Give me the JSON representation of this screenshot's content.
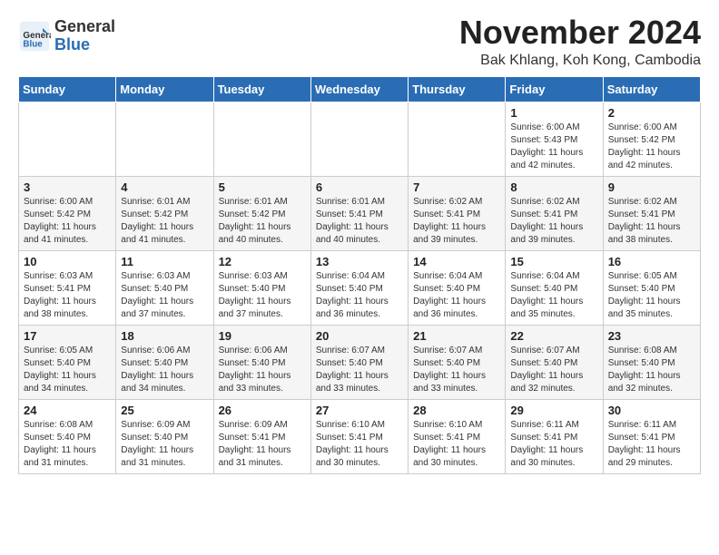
{
  "header": {
    "logo_general": "General",
    "logo_blue": "Blue",
    "month_title": "November 2024",
    "location": "Bak Khlang, Koh Kong, Cambodia"
  },
  "days_of_week": [
    "Sunday",
    "Monday",
    "Tuesday",
    "Wednesday",
    "Thursday",
    "Friday",
    "Saturday"
  ],
  "weeks": [
    [
      {
        "day": "",
        "info": ""
      },
      {
        "day": "",
        "info": ""
      },
      {
        "day": "",
        "info": ""
      },
      {
        "day": "",
        "info": ""
      },
      {
        "day": "",
        "info": ""
      },
      {
        "day": "1",
        "info": "Sunrise: 6:00 AM\nSunset: 5:43 PM\nDaylight: 11 hours and 42 minutes."
      },
      {
        "day": "2",
        "info": "Sunrise: 6:00 AM\nSunset: 5:42 PM\nDaylight: 11 hours and 42 minutes."
      }
    ],
    [
      {
        "day": "3",
        "info": "Sunrise: 6:00 AM\nSunset: 5:42 PM\nDaylight: 11 hours and 41 minutes."
      },
      {
        "day": "4",
        "info": "Sunrise: 6:01 AM\nSunset: 5:42 PM\nDaylight: 11 hours and 41 minutes."
      },
      {
        "day": "5",
        "info": "Sunrise: 6:01 AM\nSunset: 5:42 PM\nDaylight: 11 hours and 40 minutes."
      },
      {
        "day": "6",
        "info": "Sunrise: 6:01 AM\nSunset: 5:41 PM\nDaylight: 11 hours and 40 minutes."
      },
      {
        "day": "7",
        "info": "Sunrise: 6:02 AM\nSunset: 5:41 PM\nDaylight: 11 hours and 39 minutes."
      },
      {
        "day": "8",
        "info": "Sunrise: 6:02 AM\nSunset: 5:41 PM\nDaylight: 11 hours and 39 minutes."
      },
      {
        "day": "9",
        "info": "Sunrise: 6:02 AM\nSunset: 5:41 PM\nDaylight: 11 hours and 38 minutes."
      }
    ],
    [
      {
        "day": "10",
        "info": "Sunrise: 6:03 AM\nSunset: 5:41 PM\nDaylight: 11 hours and 38 minutes."
      },
      {
        "day": "11",
        "info": "Sunrise: 6:03 AM\nSunset: 5:40 PM\nDaylight: 11 hours and 37 minutes."
      },
      {
        "day": "12",
        "info": "Sunrise: 6:03 AM\nSunset: 5:40 PM\nDaylight: 11 hours and 37 minutes."
      },
      {
        "day": "13",
        "info": "Sunrise: 6:04 AM\nSunset: 5:40 PM\nDaylight: 11 hours and 36 minutes."
      },
      {
        "day": "14",
        "info": "Sunrise: 6:04 AM\nSunset: 5:40 PM\nDaylight: 11 hours and 36 minutes."
      },
      {
        "day": "15",
        "info": "Sunrise: 6:04 AM\nSunset: 5:40 PM\nDaylight: 11 hours and 35 minutes."
      },
      {
        "day": "16",
        "info": "Sunrise: 6:05 AM\nSunset: 5:40 PM\nDaylight: 11 hours and 35 minutes."
      }
    ],
    [
      {
        "day": "17",
        "info": "Sunrise: 6:05 AM\nSunset: 5:40 PM\nDaylight: 11 hours and 34 minutes."
      },
      {
        "day": "18",
        "info": "Sunrise: 6:06 AM\nSunset: 5:40 PM\nDaylight: 11 hours and 34 minutes."
      },
      {
        "day": "19",
        "info": "Sunrise: 6:06 AM\nSunset: 5:40 PM\nDaylight: 11 hours and 33 minutes."
      },
      {
        "day": "20",
        "info": "Sunrise: 6:07 AM\nSunset: 5:40 PM\nDaylight: 11 hours and 33 minutes."
      },
      {
        "day": "21",
        "info": "Sunrise: 6:07 AM\nSunset: 5:40 PM\nDaylight: 11 hours and 33 minutes."
      },
      {
        "day": "22",
        "info": "Sunrise: 6:07 AM\nSunset: 5:40 PM\nDaylight: 11 hours and 32 minutes."
      },
      {
        "day": "23",
        "info": "Sunrise: 6:08 AM\nSunset: 5:40 PM\nDaylight: 11 hours and 32 minutes."
      }
    ],
    [
      {
        "day": "24",
        "info": "Sunrise: 6:08 AM\nSunset: 5:40 PM\nDaylight: 11 hours and 31 minutes."
      },
      {
        "day": "25",
        "info": "Sunrise: 6:09 AM\nSunset: 5:40 PM\nDaylight: 11 hours and 31 minutes."
      },
      {
        "day": "26",
        "info": "Sunrise: 6:09 AM\nSunset: 5:41 PM\nDaylight: 11 hours and 31 minutes."
      },
      {
        "day": "27",
        "info": "Sunrise: 6:10 AM\nSunset: 5:41 PM\nDaylight: 11 hours and 30 minutes."
      },
      {
        "day": "28",
        "info": "Sunrise: 6:10 AM\nSunset: 5:41 PM\nDaylight: 11 hours and 30 minutes."
      },
      {
        "day": "29",
        "info": "Sunrise: 6:11 AM\nSunset: 5:41 PM\nDaylight: 11 hours and 30 minutes."
      },
      {
        "day": "30",
        "info": "Sunrise: 6:11 AM\nSunset: 5:41 PM\nDaylight: 11 hours and 29 minutes."
      }
    ]
  ]
}
